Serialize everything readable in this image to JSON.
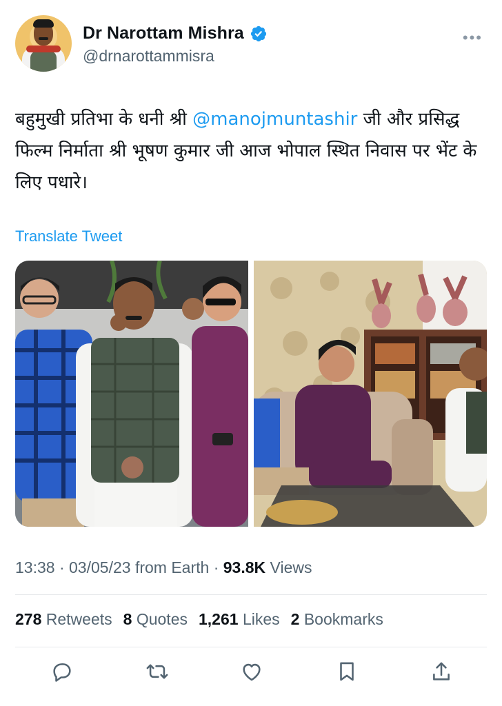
{
  "author": {
    "name": "Dr Narottam Mishra",
    "handle": "@drnarottammisra"
  },
  "menu": {
    "more_label": "•••"
  },
  "tweet": {
    "text_before": "बहुमुखी प्रतिभा के धनी श्री ",
    "mention": "@manojmuntashir",
    "text_after": " जी और प्रसिद्ध फिल्म निर्माता श्री भूषण कुमार जी आज भोपाल स्थित निवास पर भेंट के लिए पधारे।",
    "translate_label": "Translate Tweet"
  },
  "meta": {
    "time": "13:38",
    "date": "03/05/23",
    "source": "from Earth",
    "views_count": "93.8K",
    "views_label": "Views",
    "separator": "·"
  },
  "stats": {
    "retweets_count": "278",
    "retweets_label": "Retweets",
    "quotes_count": "8",
    "quotes_label": "Quotes",
    "likes_count": "1,261",
    "likes_label": "Likes",
    "bookmarks_count": "2",
    "bookmarks_label": "Bookmarks"
  },
  "icons": {
    "verified": "verified-badge-icon",
    "reply": "reply-icon",
    "retweet": "retweet-icon",
    "like": "heart-icon",
    "bookmark": "bookmark-icon",
    "share": "share-icon"
  },
  "colors": {
    "accent": "#1d9bf0",
    "secondary_text": "#536471",
    "primary_text": "#0f1419",
    "icon": "#536471"
  }
}
